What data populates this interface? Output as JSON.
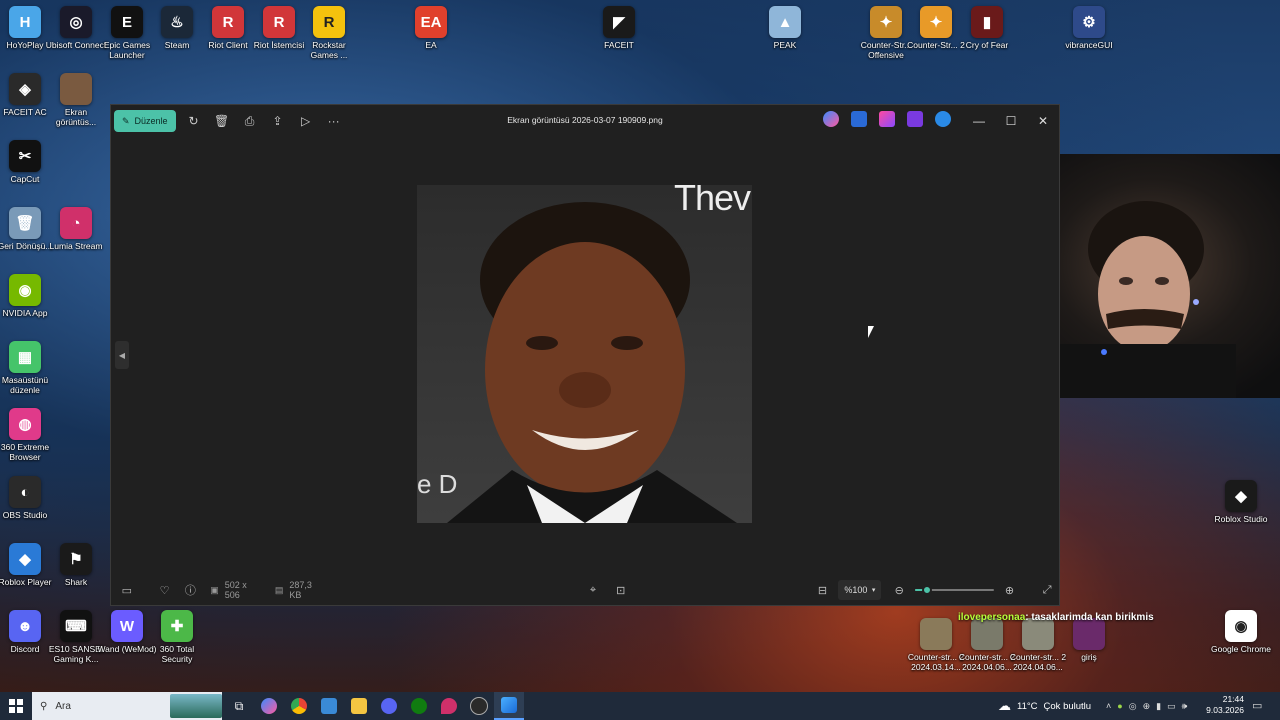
{
  "desktop_icons": [
    {
      "label": "HoYoPlay",
      "icon": "hoyoplay-icon",
      "color": "#4aa6e8",
      "glyph": "H"
    },
    {
      "label": "Ubisoft Connect",
      "icon": "ubisoft-icon",
      "color": "#1a1a2a",
      "glyph": "◎"
    },
    {
      "label": "Epic Games Launcher",
      "icon": "epic-games-icon",
      "color": "#111111",
      "glyph": "E"
    },
    {
      "label": "Steam",
      "icon": "steam-icon",
      "color": "#1b2838",
      "glyph": "♨"
    },
    {
      "label": "Riot Client",
      "icon": "riot-client-icon",
      "color": "#d13639",
      "glyph": "R"
    },
    {
      "label": "Riot İstemcisi",
      "icon": "riot-client-icon",
      "color": "#d13639",
      "glyph": "R"
    },
    {
      "label": "Rockstar Games ...",
      "icon": "rockstar-icon",
      "color": "#f4c20d",
      "glyph": "R"
    },
    {
      "label": "EA",
      "icon": "ea-icon",
      "color": "#e0402c",
      "glyph": "EA"
    },
    {
      "label": "FACEIT",
      "icon": "faceit-icon",
      "color": "#1a1a1a",
      "glyph": "◤"
    },
    {
      "label": "PEAK",
      "icon": "peak-icon",
      "color": "#8fb6d9",
      "glyph": "▲"
    },
    {
      "label": "Counter-Str... Offensive",
      "icon": "counter-strike-icon",
      "color": "#c88b2a",
      "glyph": "✦"
    },
    {
      "label": "Counter-Str... 2",
      "icon": "counter-strike-icon",
      "color": "#e89a28",
      "glyph": "✦"
    },
    {
      "label": "Cry of Fear",
      "icon": "cry-of-fear-icon",
      "color": "#6a1a1a",
      "glyph": "▮"
    },
    {
      "label": "vibranceGUI",
      "icon": "gear-icon",
      "color": "#2e4a8a",
      "glyph": "⚙"
    },
    {
      "label": "FACEIT AC",
      "icon": "faceit-ac-icon",
      "color": "#2a2a2a",
      "glyph": "◈"
    },
    {
      "label": "Ekran görüntüs...",
      "icon": "image-file-icon",
      "color": "#7a5a40",
      "glyph": ""
    },
    {
      "label": "CapCut",
      "icon": "capcut-icon",
      "color": "#111111",
      "glyph": "✂"
    },
    {
      "label": "Geri Dönüşü...",
      "icon": "recycle-bin-icon",
      "color": "#7a9ab8",
      "glyph": "🗑"
    },
    {
      "label": "Lumia Stream",
      "icon": "lumia-stream-icon",
      "color": "#d0306a",
      "glyph": "◔"
    },
    {
      "label": "NVIDIA App",
      "icon": "nvidia-icon",
      "color": "#76b900",
      "glyph": "◉"
    },
    {
      "label": "Masaüstünü düzenle",
      "icon": "desktop-organize-icon",
      "color": "#45c46a",
      "glyph": "▦"
    },
    {
      "label": "360 Extreme Browser",
      "icon": "browser-360-icon",
      "color": "#e03a8a",
      "glyph": "◍"
    },
    {
      "label": "OBS Studio",
      "icon": "obs-icon",
      "color": "#2a2a2a",
      "glyph": "◐"
    },
    {
      "label": "Roblox Player",
      "icon": "roblox-icon",
      "color": "#2a7ad6",
      "glyph": "◆"
    },
    {
      "label": "Shark",
      "icon": "shark-icon",
      "color": "#1a1a1a",
      "glyph": "⚑"
    },
    {
      "label": "Discord",
      "icon": "discord-icon",
      "color": "#5865f2",
      "glyph": "☻"
    },
    {
      "label": "ES10 SANSEI Gaming K...",
      "icon": "keyboard-icon",
      "color": "#111111",
      "glyph": "⌨"
    },
    {
      "label": "Wand (WeMod)",
      "icon": "wand-icon",
      "color": "#6b5cff",
      "glyph": "W"
    },
    {
      "label": "360 Total Security",
      "icon": "security-360-icon",
      "color": "#4cb848",
      "glyph": "✚"
    },
    {
      "label": "Roblox Studio",
      "icon": "roblox-studio-icon",
      "color": "#1a1a1a",
      "glyph": "◆"
    },
    {
      "label": "Google Chrome",
      "icon": "chrome-icon",
      "color": "#ffffff",
      "glyph": "◉"
    },
    {
      "label": "Counter-str... 2 2024.03.14...",
      "icon": "image-file-icon",
      "color": "#8a7a5a",
      "glyph": ""
    },
    {
      "label": "Counter-str... 2 2024.04.06...",
      "icon": "image-file-icon",
      "color": "#7a7a6a",
      "glyph": ""
    },
    {
      "label": "Counter-str... 2 2024.04.06...",
      "icon": "image-file-icon",
      "color": "#8a8a7a",
      "glyph": ""
    },
    {
      "label": "giriş",
      "icon": "image-file-icon",
      "color": "#6a2a6a",
      "glyph": ""
    }
  ],
  "viewer": {
    "edit_label": "Düzenle",
    "title": "Ekran görüntüsü 2026-03-07 190909.png",
    "dimensions": "502 x 506",
    "file_size": "287,3 KB",
    "zoom": "%100",
    "zoom_level": 0.15,
    "photo_text": "Thev",
    "photo_text2": "e D"
  },
  "chat": {
    "user": "ilovepersonaa",
    "message": ": tasaklarimda kan birikmis"
  },
  "taskbar": {
    "search_placeholder": "Ara",
    "weather_temp": "11°C",
    "weather_desc": "Çok bulutlu",
    "time": "21:44",
    "date": "9.03.2026"
  },
  "colors": {
    "accent": "#4cc2a8",
    "window_bg": "#202020",
    "chat_user": "#b6ff3a"
  }
}
